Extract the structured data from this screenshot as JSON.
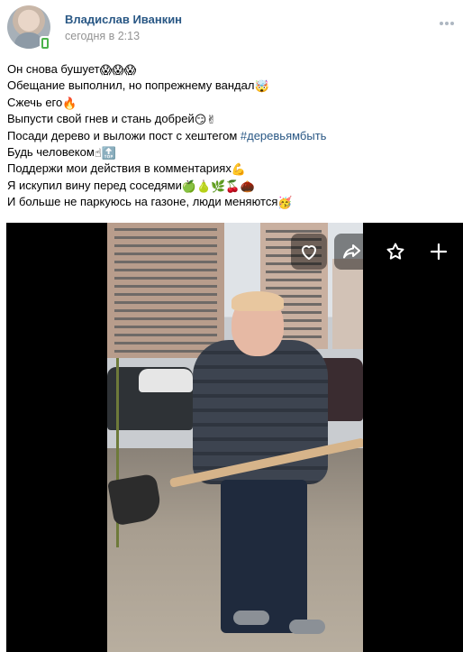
{
  "post": {
    "author": "Владислав Иванкин",
    "time": "сегодня в 2:13",
    "lines": [
      {
        "text": "Он снова бушует",
        "emoji": "😱😱😱"
      },
      {
        "text": "Обещание выполнил, но попрежнему вандал",
        "emoji": "🤯"
      },
      {
        "text": "Сжечь его",
        "emoji": "🔥"
      },
      {
        "text": "Выпусти свой гнев и стань добрей",
        "emoji": "😏✌"
      },
      {
        "text": "Посади дерево и выложи пост с хештегом ",
        "hashtag": "#деревьямбыть"
      },
      {
        "text": "Будь человеком",
        "emoji": "☝🔝"
      },
      {
        "text": "Поддержи мои действия в комментариях",
        "emoji": "💪"
      },
      {
        "text": "Я искупил вину перед соседями",
        "emoji": "🍏🍐🌿🍒🌰"
      },
      {
        "text": "И больше не паркуюсь на газоне, люди меняются",
        "emoji": "🥳"
      }
    ]
  },
  "video_controls": {
    "like": "heart-icon",
    "share": "share-icon",
    "favorite": "star-icon",
    "add": "plus-icon"
  },
  "colors": {
    "link": "#2a5885",
    "muted": "#939393",
    "online": "#4bb34b"
  }
}
